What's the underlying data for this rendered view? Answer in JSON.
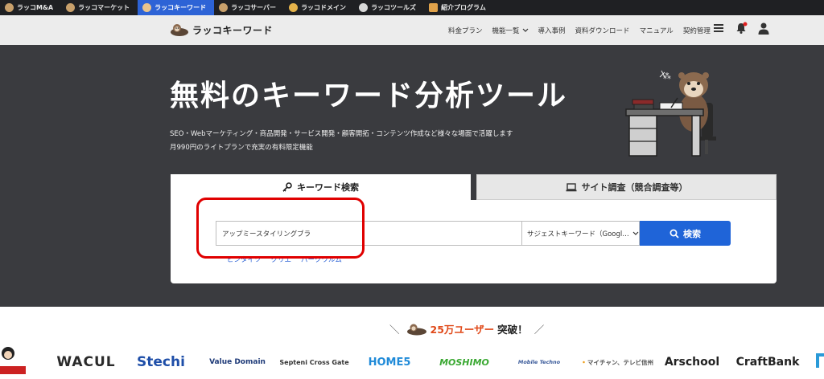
{
  "topbar": {
    "items": [
      {
        "label": "ラッコM&A",
        "icon": "otter-icon",
        "active": false
      },
      {
        "label": "ラッコマーケット",
        "icon": "otter-icon",
        "active": false
      },
      {
        "label": "ラッコキーワード",
        "icon": "otter-icon",
        "active": true
      },
      {
        "label": "ラッコサーバー",
        "icon": "otter-icon",
        "active": false
      },
      {
        "label": "ラッコドメイン",
        "icon": "otter-icon",
        "active": false
      },
      {
        "label": "ラッコツールズ",
        "icon": "otter-icon",
        "active": false
      },
      {
        "label": "紹介プログラム",
        "icon": "gift-icon",
        "active": false
      }
    ]
  },
  "header": {
    "logo_text": "ラッコキーワード",
    "nav": [
      "料金プラン",
      "機能一覧",
      "導入事例",
      "資料ダウンロード",
      "マニュアル",
      "契約管理"
    ]
  },
  "hero": {
    "title": "無料のキーワード分析ツール",
    "subtitle_1": "SEO・Webマーケティング・商品開発・サービス開発・顧客開拓・コンテンツ作成など様々な場面で活躍します",
    "subtitle_2": "月990円のライトプランで充実の有料限定機能"
  },
  "search": {
    "tab_keyword": "キーワード検索",
    "tab_site": "サイト調査（競合調査等）",
    "input_value": "アップミースタイリングブラ",
    "select_value": "サジェストキーワード（Googl…",
    "button_label": "検索",
    "modes": [
      "ピンタイツ",
      "クリエ",
      "パークワルム"
    ]
  },
  "users": {
    "count": "25万ユーザー",
    "suffix": "突破！"
  },
  "logos": [
    "WACUL",
    "Stechi",
    "Value Domain",
    "Septeni Cross Gate",
    "HOME5",
    "MOSHIMO",
    "Mobile Techno",
    "マイチャン、テレビ信州",
    "Arschool",
    "CraftBank"
  ],
  "colors": {
    "accent": "#1f64d8",
    "highlight": "#e00000",
    "hero_bg": "#3a3b3f"
  }
}
